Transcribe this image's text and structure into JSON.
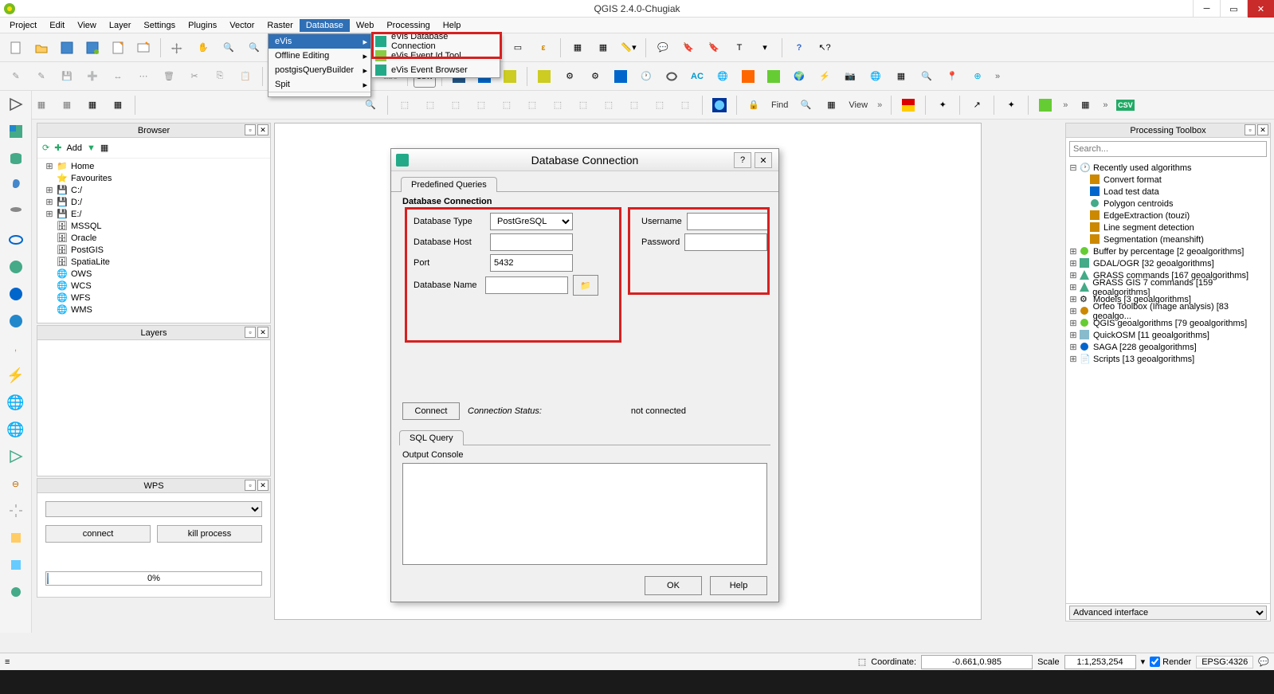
{
  "titlebar": {
    "title": "QGIS 2.4.0-Chugiak"
  },
  "menubar": {
    "items": [
      "Project",
      "Edit",
      "View",
      "Layer",
      "Settings",
      "Plugins",
      "Vector",
      "Raster",
      "Database",
      "Web",
      "Processing",
      "Help"
    ],
    "active_index": 8
  },
  "db_menu": {
    "items": [
      "eVis",
      "Offline Editing",
      "postgisQueryBuilder",
      "Spit"
    ],
    "active_index": 0
  },
  "evis_submenu": {
    "items": [
      "eVis Database Connection",
      "eVis Event Id Tool",
      "eVis Event Browser"
    ]
  },
  "toolbar3": {
    "find_label": "Find",
    "view_label": "View",
    "csv_label": "CSV"
  },
  "browser": {
    "title": "Browser",
    "add_label": "Add",
    "items": [
      "Home",
      "Favourites",
      "C:/",
      "D:/",
      "E:/",
      "MSSQL",
      "Oracle",
      "PostGIS",
      "SpatiaLite",
      "OWS",
      "WCS",
      "WFS",
      "WMS"
    ]
  },
  "layers": {
    "title": "Layers"
  },
  "wps": {
    "title": "WPS",
    "connect": "connect",
    "kill": "kill process",
    "progress": "0%"
  },
  "toolbox": {
    "title": "Processing Toolbox",
    "search_placeholder": "Search...",
    "recent_label": "Recently used algorithms",
    "recent": [
      "Convert format",
      "Load test data",
      "Polygon centroids",
      "EdgeExtraction (touzi)",
      "Line segment detection",
      "Segmentation (meanshift)"
    ],
    "groups": [
      "Buffer by percentage [2 geoalgorithms]",
      "GDAL/OGR [32 geoalgorithms]",
      "GRASS commands [167 geoalgorithms]",
      "GRASS GIS 7 commands [159 geoalgorithms]",
      "Models [3 geoalgorithms]",
      "Orfeo Toolbox (Image analysis) [83 geoalgo...",
      "QGIS geoalgorithms [79 geoalgorithms]",
      "QuickOSM [11 geoalgorithms]",
      "SAGA [228 geoalgorithms]",
      "Scripts [13 geoalgorithms]"
    ],
    "interface": "Advanced interface"
  },
  "statusbar": {
    "coord_label": "Coordinate:",
    "coord_value": "-0.661,0.985",
    "scale_label": "Scale",
    "scale_value": "1:1,253,254",
    "render_label": "Render",
    "epsg": "EPSG:4326"
  },
  "dialog": {
    "title": "Database Connection",
    "tab_predef": "Predefined Queries",
    "section": "Database Connection",
    "db_type_label": "Database Type",
    "db_type_value": "PostGreSQL",
    "db_host_label": "Database Host",
    "db_host_value": "",
    "port_label": "Port",
    "port_value": "5432",
    "db_name_label": "Database Name",
    "db_name_value": "",
    "user_label": "Username",
    "user_value": "",
    "pass_label": "Password",
    "pass_value": "",
    "connect": "Connect",
    "status_label": "Connection Status:",
    "status_value": "not connected",
    "sql_tab": "SQL Query",
    "out_label": "Output Console",
    "ok": "OK",
    "help": "Help"
  }
}
